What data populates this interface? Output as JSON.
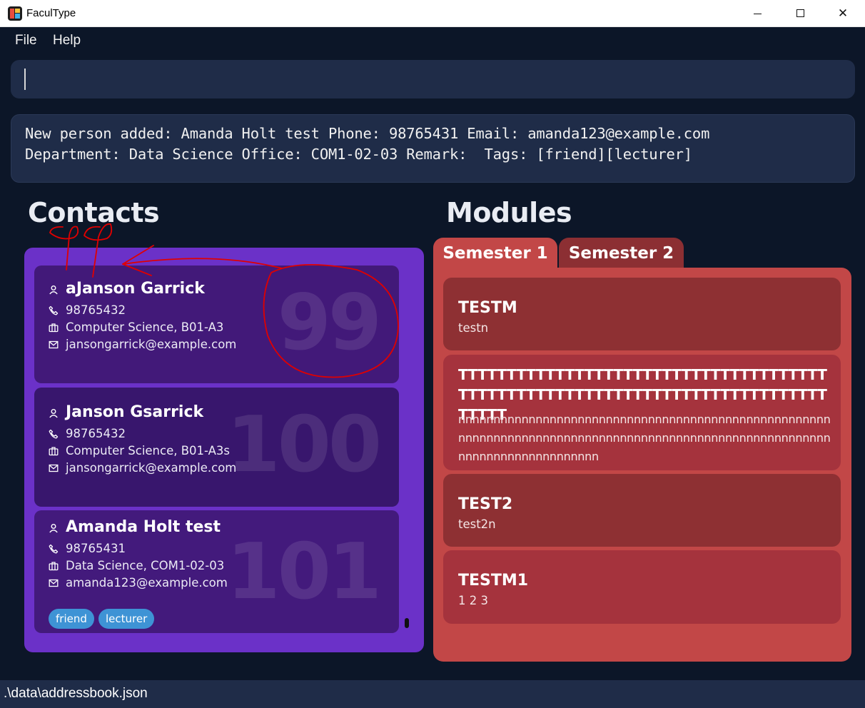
{
  "window": {
    "title": "FaculType",
    "minimize_icon": "minimize-icon",
    "maximize_icon": "maximize-icon",
    "close_icon": "close-icon",
    "close_glyph": "✕"
  },
  "menu": {
    "items": [
      "File",
      "Help"
    ]
  },
  "command": {
    "value": "",
    "placeholder": ""
  },
  "result": {
    "lines": [
      "New person added: Amanda Holt test Phone: 98765431 Email: amanda123@example.com",
      "Department: Data Science Office: COM1-02-03 Remark:  Tags: [friend][lecturer]"
    ]
  },
  "contacts": {
    "heading": "Contacts",
    "list": [
      {
        "index": "99",
        "name": "aJanson Garrick",
        "phone": "98765432",
        "department_office": "Computer Science, B01-A3",
        "email": "jansongarrick@example.com",
        "tags": []
      },
      {
        "index": "100",
        "name": "Janson Gsarrick",
        "phone": "98765432",
        "department_office": "Computer Science, B01-A3s",
        "email": "jansongarrick@example.com",
        "tags": []
      },
      {
        "index": "101",
        "name": "Amanda Holt test",
        "phone": "98765431",
        "department_office": "Data Science, COM1-02-03",
        "email": "amanda123@example.com",
        "tags": [
          "friend",
          "lecturer"
        ]
      }
    ],
    "icons": {
      "name": "person-icon",
      "phone": "phone-icon",
      "office": "briefcase-icon",
      "email": "mail-icon"
    }
  },
  "modules": {
    "heading": "Modules",
    "tabs": [
      "Semester 1",
      "Semester 2"
    ],
    "selected_tab": "Semester 1",
    "list": [
      {
        "code": "TESTM",
        "description": "testn"
      },
      {
        "code": "TTTTTTTTTTTTTTTTTTTTTTTTTTTTTTTTTTTTTTTTTTTTTTTTTTTTTTTTTTTTTTTTTTTTTTTTTTTTTTTTT",
        "description": "nnnnnnnnnnnnnnnnnnnnnnnnnnnnnnnnnnnnnnnnnnnnnnnnnnnnnnnnnnnnnnnnnnnnnnnnnnnnnnnnnnnnnnnnnnnnnnnnnnnnnnnnnnnnnnnnnnnnnnnnnnnnnn"
      },
      {
        "code": "TEST2",
        "description": "test2n"
      },
      {
        "code": "TESTM1",
        "description": "1 2 3"
      }
    ]
  },
  "status": {
    "path": ".\\data\\addressbook.json"
  },
  "colors": {
    "background": "#0c1628",
    "input_box": "#1f2c48",
    "contacts_panel": "#6b31c8",
    "contact_card": "#401877",
    "modules_panel": "#c24747",
    "module_card_dark": "#8e3033",
    "module_card_light": "#a5333d",
    "tag": "#3e93d5",
    "annotation": "#e00000"
  }
}
